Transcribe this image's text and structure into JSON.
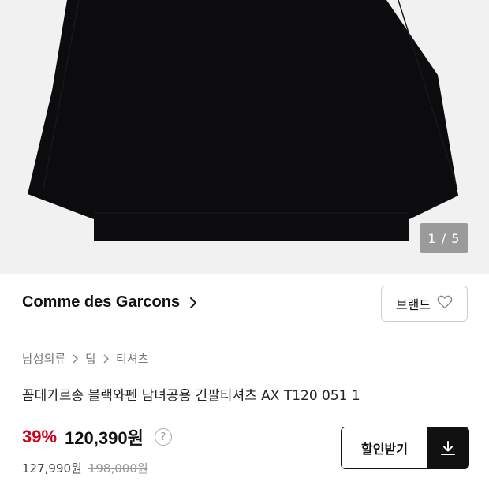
{
  "gallery": {
    "counter": "1 / 5"
  },
  "brand": {
    "name": "Comme des Garcons",
    "button_label": "브랜드"
  },
  "breadcrumb": [
    "남성의류",
    "탑",
    "티셔츠"
  ],
  "product": {
    "title": "꼼데가르송 블랙와펜 남녀공용 긴팔티셔츠 AX T120 051 1"
  },
  "pricing": {
    "discount": "39%",
    "price": "120,390원",
    "help_symbol": "?",
    "original_price": "127,990원",
    "list_price": "198,000원"
  },
  "coupon": {
    "label": "할인받기"
  },
  "colors": {
    "discount": "#d0021b",
    "garment": "#0c0c0e",
    "background": "#f1f1f1"
  }
}
